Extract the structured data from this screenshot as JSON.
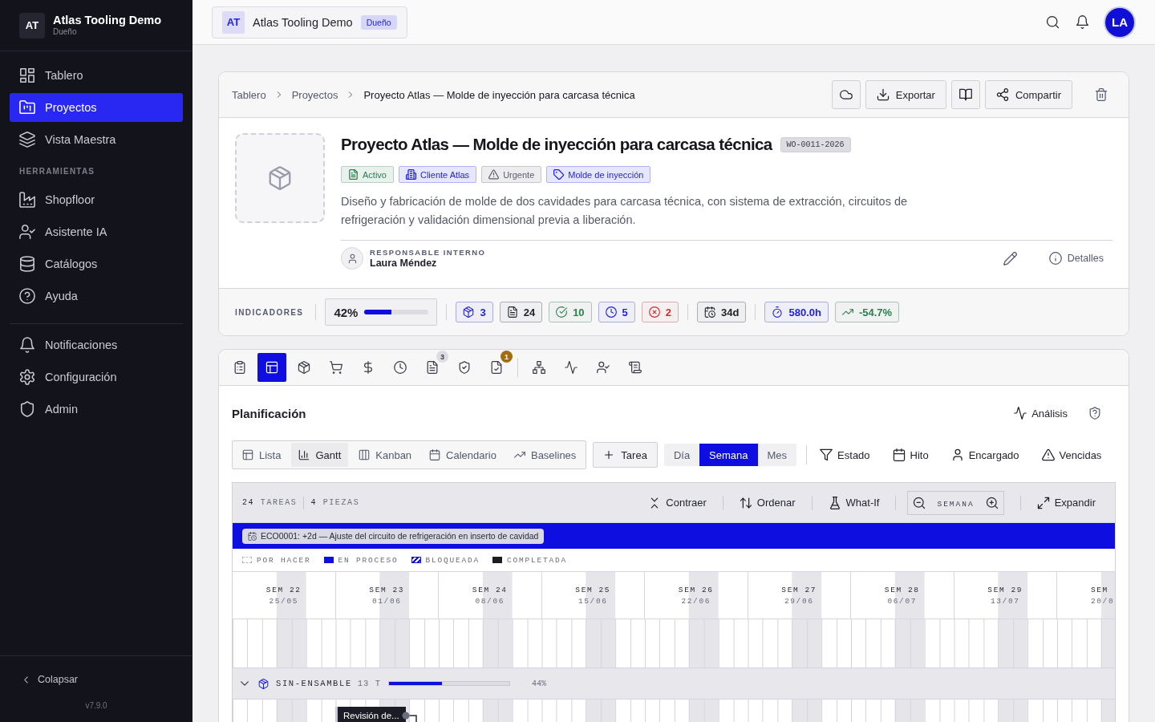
{
  "sidebar": {
    "workspace": {
      "initials": "AT",
      "name": "Atlas Tooling Demo",
      "role": "Dueño"
    },
    "sections": [
      {
        "items": [
          {
            "label": "Tablero",
            "selected": false
          },
          {
            "label": "Proyectos",
            "selected": true
          },
          {
            "label": "Vista Maestra",
            "selected": false
          }
        ]
      },
      {
        "title": "HERRAMIENTAS",
        "items": [
          {
            "label": "Shopfloor",
            "selected": false
          },
          {
            "label": "Asistente IA",
            "selected": false
          },
          {
            "label": "Catálogos",
            "selected": false
          },
          {
            "label": "Ayuda",
            "selected": false
          }
        ]
      },
      {
        "items": [
          {
            "label": "Notificaciones",
            "selected": false
          },
          {
            "label": "Configuración",
            "selected": false
          },
          {
            "label": "Admin",
            "selected": false
          }
        ]
      }
    ],
    "collapse": "Colapsar",
    "version": "v7.9.0"
  },
  "topbar": {
    "workspace": {
      "initials": "AT",
      "name": "Atlas Tooling Demo",
      "role": "Dueño"
    },
    "user_initials": "LA"
  },
  "project": {
    "breadcrumb": [
      "Tablero",
      "Proyectos",
      "Proyecto Atlas — Molde de inyección para carcasa técnica"
    ],
    "actions": [
      {
        "kind": "icon"
      },
      {
        "kind": "labeled",
        "label": "Exportar"
      },
      {
        "kind": "icon"
      },
      {
        "kind": "labeled",
        "label": "Compartir"
      },
      {
        "kind": "bare"
      }
    ],
    "title": "Proyecto Atlas — Molde de inyección para carcasa técnica",
    "code": "WO-0011-2026",
    "tags": [
      {
        "label": "Activo",
        "color": "#2e7d4f"
      },
      {
        "label": "Cliente Atlas",
        "color": "#1f1fe0"
      },
      {
        "label": "Urgente",
        "color": "#5b5d6b"
      },
      {
        "label": "Molde de inyección",
        "color": "#1f1fe0"
      }
    ],
    "description": "Diseño y fabricación de molde de dos cavidades para carcasa técnica, con sistema de extracción, circuitos de refrigeración y validación dimensional previa a liberación.",
    "owner": {
      "label": "RESPONSABLE INTERNO",
      "name": "Laura Méndez"
    },
    "details": "Detalles",
    "indicators": {
      "label": "INDICADORES",
      "progress": {
        "text": "42%",
        "level": 0.42
      },
      "groups": [
        [
          {
            "value": "3",
            "color": "#1f1fe0"
          },
          {
            "value": "24",
            "color": "#22232b"
          },
          {
            "value": "10",
            "color": "#2e7d4f"
          },
          {
            "value": "5",
            "color": "#1f1fe0"
          },
          {
            "value": "2",
            "color": "#d42a2a"
          }
        ],
        [
          {
            "value": "34d",
            "color": "#22232b"
          }
        ],
        [
          {
            "value": "580.0h",
            "color": "#1f1fe0"
          },
          {
            "value": "-54.7%",
            "color": "#2e7d4f"
          }
        ]
      ]
    }
  },
  "workspace_tabs": [
    [
      {
        "selected": false
      },
      {
        "selected": true
      },
      {
        "selected": false
      },
      {
        "selected": false
      },
      {
        "selected": false
      },
      {
        "selected": false
      },
      {
        "selected": false,
        "badge": {
          "text": "3",
          "kind": "count"
        }
      },
      {
        "selected": false
      },
      {
        "selected": false,
        "badge": {
          "text": "1",
          "kind": "alert"
        }
      }
    ],
    [
      {
        "selected": false
      },
      {
        "selected": false
      },
      {
        "selected": false
      },
      {
        "selected": false
      }
    ]
  ],
  "planning": {
    "title": "Planificación",
    "analysis": "Análisis",
    "views": [
      {
        "label": "Lista",
        "selected": false
      },
      {
        "label": "Gantt",
        "selected": true
      },
      {
        "label": "Kanban",
        "selected": false
      },
      {
        "label": "Calendario",
        "selected": false
      },
      {
        "label": "Baselines",
        "selected": false
      }
    ],
    "add_task": "Tarea",
    "scales": [
      {
        "label": "Día",
        "selected": false
      },
      {
        "label": "Semana",
        "selected": true
      },
      {
        "label": "Mes",
        "selected": false
      }
    ],
    "filters": [
      "Estado",
      "Hito",
      "Encargado",
      "Vencidas"
    ],
    "gantt": {
      "counts": [
        {
          "number": "24",
          "label": "TAREAS"
        },
        {
          "number": "4",
          "label": "PIEZAS"
        }
      ],
      "tools": [
        "Contraer",
        "Ordenar",
        "What-If"
      ],
      "zoom": "SEMANA",
      "expand": "Expandir",
      "banner": "ECO0001: +2d — Ajuste del circuito de refrigeración en inserto de cavidad",
      "legend": [
        {
          "kind": "todo",
          "label": "POR HACER"
        },
        {
          "kind": "progress",
          "label": "EN PROCESO"
        },
        {
          "kind": "blocked",
          "label": "BLOQUEADA"
        },
        {
          "kind": "done",
          "label": "COMPLETADA"
        }
      ],
      "weeks": [
        {
          "label": "SEM 22",
          "date": "25/05"
        },
        {
          "label": "SEM 23",
          "date": "01/06"
        },
        {
          "label": "SEM 24",
          "date": "08/06"
        },
        {
          "label": "SEM 25",
          "date": "15/06"
        },
        {
          "label": "SEM 26",
          "date": "22/06"
        },
        {
          "label": "SEM 27",
          "date": "29/06"
        },
        {
          "label": "SEM 28",
          "date": "06/07"
        },
        {
          "label": "SEM 29",
          "date": "13/07"
        },
        {
          "label": "SEM",
          "date": "20/0"
        }
      ],
      "groups": [
        {
          "name": "SIN-ENSAMBLE",
          "count": "13 T",
          "level": 0.44,
          "percent": "44%",
          "expanded": true,
          "tasks": [
            {
              "label": "Revisión de..."
            }
          ]
        }
      ]
    }
  }
}
